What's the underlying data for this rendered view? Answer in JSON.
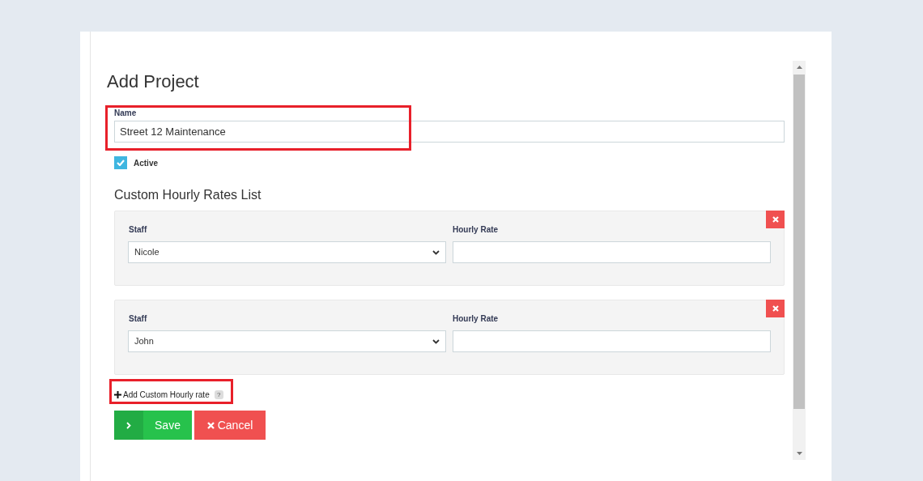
{
  "title": "Add Project",
  "name_field": {
    "label": "Name",
    "value": "Street 12 Maintenance"
  },
  "active": {
    "label": "Active",
    "checked": true
  },
  "rates_heading": "Custom Hourly Rates List",
  "rates": [
    {
      "staff_label": "Staff",
      "staff": "Nicole",
      "rate_label": "Hourly Rate"
    },
    {
      "staff_label": "Staff",
      "staff": "John",
      "rate_label": "Hourly Rate"
    }
  ],
  "add_link": {
    "label": "Add Custom Hourly rate",
    "help": "?"
  },
  "buttons": [
    {
      "kind": "save",
      "label": "Save"
    },
    {
      "kind": "cancel",
      "label": "Cancel"
    }
  ]
}
